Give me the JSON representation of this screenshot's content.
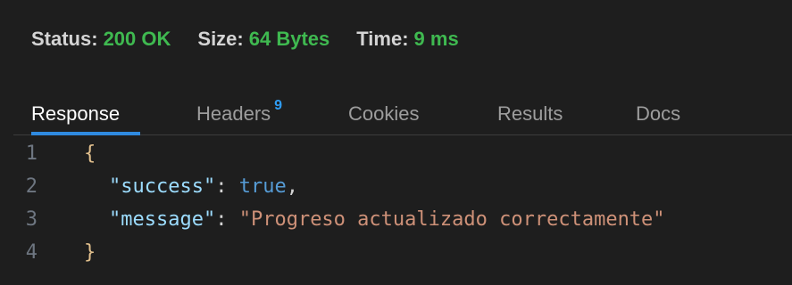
{
  "status_bar": {
    "status_label": "Status:",
    "status_value": "200 OK",
    "size_label": "Size:",
    "size_value": "64 Bytes",
    "time_label": "Time:",
    "time_value": "9 ms"
  },
  "tabs": [
    {
      "label": "Response",
      "active": true
    },
    {
      "label": "Headers",
      "badge": "9",
      "active": false
    },
    {
      "label": "Cookies",
      "active": false
    },
    {
      "label": "Results",
      "active": false
    },
    {
      "label": "Docs",
      "active": false
    }
  ],
  "response": {
    "lines": [
      {
        "number": "1",
        "open_brace": "{"
      },
      {
        "number": "2",
        "key": "\"success\"",
        "colon": ": ",
        "value": "true",
        "trail": ","
      },
      {
        "number": "3",
        "key": "\"message\"",
        "colon": ": ",
        "value": "\"Progreso actualizado correctamente\""
      },
      {
        "number": "4",
        "close_brace": "}"
      }
    ]
  },
  "colors": {
    "background": "#1e1e1e",
    "status_value": "#3fb950",
    "tab_active_underline": "#2f8ae0",
    "badge": "#2f9df4",
    "json_key": "#9cdcfe",
    "json_bool": "#569cd6",
    "json_string": "#ce9178",
    "json_brace": "#e2c08d",
    "line_number": "#6e7681"
  }
}
